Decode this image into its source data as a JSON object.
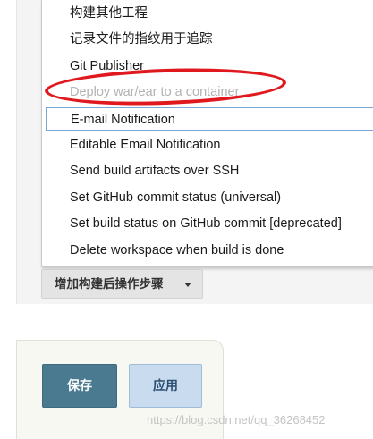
{
  "menu": {
    "items": [
      {
        "label": "构建其他工程",
        "state": "normal"
      },
      {
        "label": "记录文件的指纹用于追踪",
        "state": "normal"
      },
      {
        "label": "Git Publisher",
        "state": "normal"
      },
      {
        "label": "Deploy war/ear to a container",
        "state": "disabled"
      },
      {
        "label": "E-mail Notification",
        "state": "highlighted"
      },
      {
        "label": "Editable Email Notification",
        "state": "normal"
      },
      {
        "label": "Send build artifacts over SSH",
        "state": "normal"
      },
      {
        "label": "Set GitHub commit status (universal)",
        "state": "normal"
      },
      {
        "label": "Set build status on GitHub commit [deprecated]",
        "state": "normal"
      },
      {
        "label": "Delete workspace when build is done",
        "state": "normal"
      }
    ]
  },
  "add_post_build": {
    "label": "增加构建后操作步骤",
    "icon": "caret-down-icon"
  },
  "form_actions": {
    "save_label": "保存",
    "apply_label": "应用"
  },
  "watermark": {
    "text": "https://blog.csdn.net/qq_36268452"
  },
  "colors": {
    "annotation": "#e0191f",
    "save_button": "#4a7a90",
    "apply_button": "#c9dcef",
    "highlight_border": "#7aa7d8",
    "disabled_text": "#b2b2b2"
  }
}
